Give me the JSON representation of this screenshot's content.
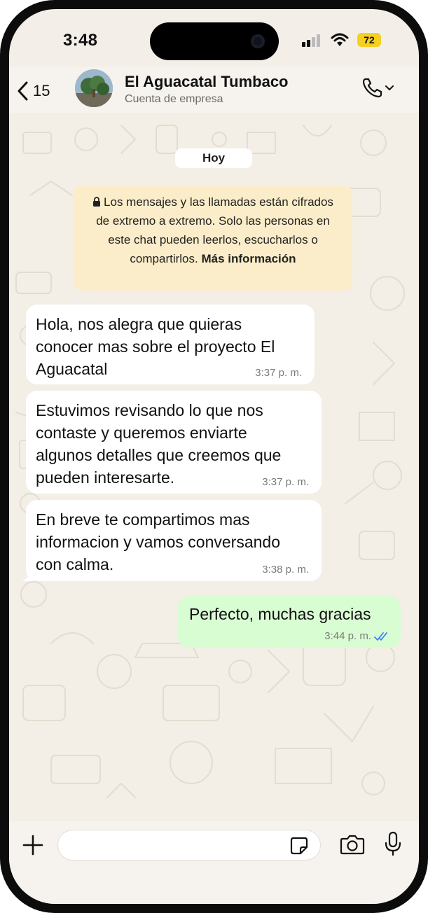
{
  "status": {
    "time": "3:48",
    "battery": "72"
  },
  "header": {
    "back_count": "15",
    "title": "El Aguacatal Tumbaco",
    "subtitle": "Cuenta de empresa"
  },
  "chat": {
    "date_chip": "Hoy",
    "encryption_notice": "Los mensajes y las llamadas están cifrados de extremo a extremo. Solo las personas en este chat pueden leerlos, escucharlos o compartirlos.",
    "encryption_link": "Más información",
    "messages": [
      {
        "text": "Hola, nos alegra que quieras\nconocer mas sobre el proyecto El\nAguacatal",
        "time": "3:37 p. m.",
        "direction": "in"
      },
      {
        "text": "Estuvimos revisando lo que nos\ncontaste y queremos enviarte\nalgunos detalles que creemos que\npueden interesarte.",
        "time": "3:37 p. m.",
        "direction": "in"
      },
      {
        "text": "En breve te compartimos mas\ninformacion y vamos conversando\ncon calma.",
        "time": "3:38 p. m.",
        "direction": "in"
      },
      {
        "text": "Perfecto, muchas gracias",
        "time": "3:44 p. m.",
        "direction": "out",
        "read": true
      }
    ]
  },
  "composer": {
    "placeholder": ""
  },
  "colors": {
    "outgoing_bubble": "#d9fdd3",
    "incoming_bubble": "#ffffff",
    "notice_bg": "#fbedc9",
    "read_ticks": "#3b82f6",
    "battery": "#f5d020"
  },
  "icons": [
    "back-chevron-icon",
    "phone-icon",
    "chevron-down-icon",
    "lock-icon",
    "double-check-icon",
    "plus-icon",
    "sticker-icon",
    "camera-icon",
    "microphone-icon",
    "wifi-icon",
    "signal-icon"
  ]
}
